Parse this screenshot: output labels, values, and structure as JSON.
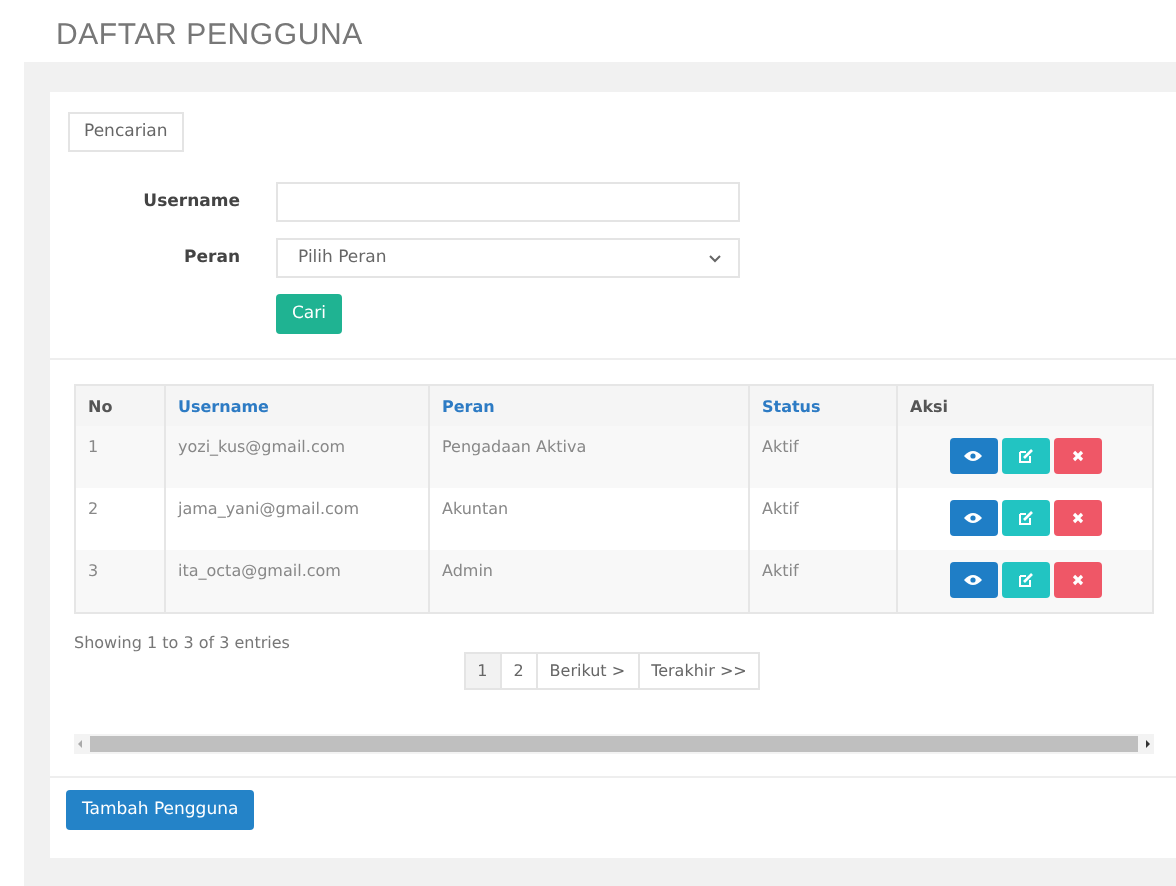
{
  "page_title": "DAFTAR PENGGUNA",
  "search_panel": {
    "tab": "Pencarian",
    "fields": [
      {
        "kind": "text",
        "label": "Username"
      },
      {
        "kind": "select",
        "label": "Peran",
        "placeholder": "Pilih Peran"
      }
    ],
    "button": "Cari"
  },
  "table": {
    "columns": [
      {
        "label": "No",
        "kind": "plain"
      },
      {
        "label": "Username",
        "kind": "sortable"
      },
      {
        "label": "Peran",
        "kind": "sortable"
      },
      {
        "label": "Status",
        "kind": "sortable"
      },
      {
        "label": "Aksi",
        "kind": "plain"
      }
    ],
    "rows": [
      {
        "cells": [
          "1",
          "yozi_kus@gmail.com",
          "Pengadaan Aktiva",
          "Aktif"
        ]
      },
      {
        "cells": [
          "2",
          "jama_yani@gmail.com",
          "Akuntan",
          "Aktif"
        ]
      },
      {
        "cells": [
          "3",
          "ita_octa@gmail.com",
          "Admin",
          "Aktif"
        ]
      }
    ]
  },
  "info": "Showing 1 to 3 of 3 entries",
  "pagination": [
    {
      "label": "1",
      "selected": true
    },
    {
      "label": "2",
      "selected": false
    },
    {
      "label": "Berikut >",
      "selected": false
    },
    {
      "label": "Terakhir >>",
      "selected": false
    }
  ],
  "add_button": "Tambah Pengguna"
}
